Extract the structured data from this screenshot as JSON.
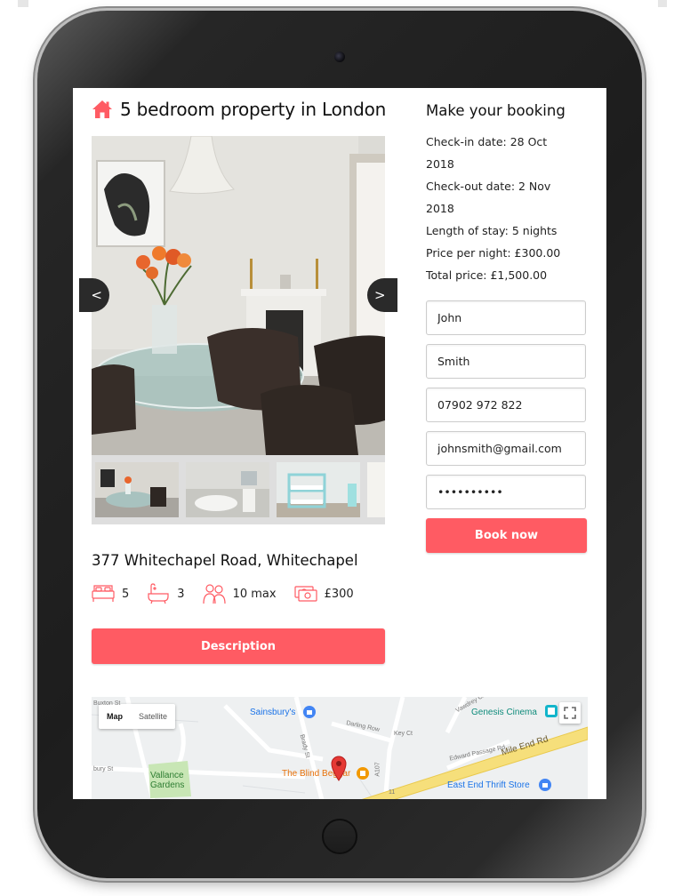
{
  "listing": {
    "title": "5 bedroom property in London",
    "address": "377 Whitechapel Road, Whitechapel",
    "features": {
      "bedrooms": "5",
      "bathrooms": "3",
      "guests": "10 max",
      "price": "£300"
    },
    "description_button": "Description"
  },
  "gallery": {
    "prev_label": "<",
    "next_label": ">"
  },
  "booking": {
    "title": "Make your booking",
    "checkin_line1": "Check-in date: 28 Oct",
    "checkin_line2": "2018",
    "checkout_line1": "Check-out date: 2 Nov",
    "checkout_line2": "2018",
    "length": "Length of stay: 5 nights",
    "price_per_night": "Price per night: £300.00",
    "total": "Total price: £1,500.00",
    "fields": {
      "first_name": "John",
      "last_name": "Smith",
      "phone": "07902 972 822",
      "email": "johnsmith@gmail.com",
      "password": "••••••••••"
    },
    "book_button": "Book now"
  },
  "map": {
    "map_tab": "Map",
    "satellite_tab": "Satellite",
    "places": {
      "sainsburys": "Sainsbury's",
      "genesis": "Genesis Cinema",
      "blind_beggar": "The Blind Beggar",
      "vallance_1": "Vallance",
      "vallance_2": "Gardens",
      "thrift": "East End Thrift Store"
    },
    "streets": {
      "mile_end": "Mile End Rd",
      "brady": "Brady St",
      "darling": "Darling Row",
      "key": "Key Ct",
      "edward": "Edward Passage Rd",
      "a107": "A107",
      "buxton": "Buxton St",
      "vawdrey": "Vawdrey Cl",
      "bury": "bury St",
      "a11": "11"
    }
  },
  "colors": {
    "accent": "#ff5b63",
    "map_road_major": "#f6df7b",
    "map_park": "#c8e6b5",
    "pin": "#e53935"
  }
}
